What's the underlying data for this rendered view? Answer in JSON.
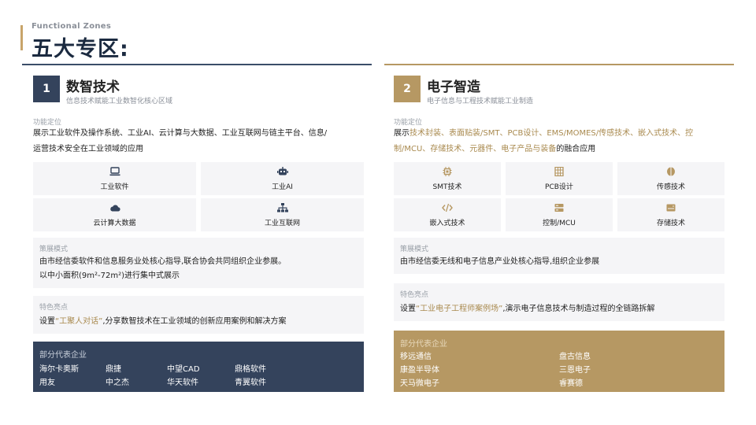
{
  "header": {
    "subtitle": "Functional Zones",
    "title": "五大专区:"
  },
  "zones": [
    {
      "number": "1",
      "title": "数智技术",
      "subtitle": "信息技术赋能工业数智化核心区域",
      "function_label": "功能定位",
      "function_text_1": "展示工业软件及操作系统、工业AI、云计算与大数据、工业互联网与链主平台、信息/",
      "function_text_2": "运营技术安全在工业领域的应用",
      "tiles": [
        {
          "label": "工业软件",
          "icon": "laptop-icon"
        },
        {
          "label": "工业AI",
          "icon": "robot-icon"
        },
        {
          "label": "云计算大数据",
          "icon": "cloud-icon"
        },
        {
          "label": "工业互联网",
          "icon": "network-icon"
        }
      ],
      "plan_label": "策展模式",
      "plan_text_1": "由市经信委软件和信息服务业处核心指导,联合协会共同组织企业参展。",
      "plan_text_2": "以中小面积(9m²-72m²)进行集中式展示",
      "feature_label": "特色亮点",
      "feature_prefix": "设置",
      "feature_highlight": "“工聚人对话”",
      "feature_suffix": ",分享数智技术在工业领域的创新应用案例和解决方案",
      "companies_label": "部分代表企业",
      "companies": [
        "海尔卡奥斯",
        "鼎捷",
        "中望CAD",
        "鼎格软件",
        "用友",
        "中之杰",
        "华天软件",
        "青翼软件"
      ]
    },
    {
      "number": "2",
      "title": "电子智造",
      "subtitle": "电子信息与工程技术赋能工业制造",
      "function_label": "功能定位",
      "function_prefix": "展示",
      "function_highlight_1": "技术封装、表面贴装/SMT、PCB设计、EMS/MOMES/传感技术、嵌入式技术、控",
      "function_highlight_2": "制/MCU、存储技术、元器件、电子产品与装备",
      "function_suffix": "的融合应用",
      "tiles": [
        {
          "label": "SMT技术",
          "icon": "chip-icon"
        },
        {
          "label": "PCB设计",
          "icon": "circuit-board-icon"
        },
        {
          "label": "传感技术",
          "icon": "sensor-icon"
        },
        {
          "label": "嵌入式技术",
          "icon": "code-icon"
        },
        {
          "label": "控制/MCU",
          "icon": "controller-icon"
        },
        {
          "label": "存储技术",
          "icon": "storage-icon"
        }
      ],
      "plan_label": "策展模式",
      "plan_text_1": "由市经信委无线和电子信息产业处核心指导,组织企业参展",
      "feature_label": "特色亮点",
      "feature_prefix": "设置",
      "feature_highlight": "“工业电子工程师案例场”",
      "feature_suffix": ",演示电子信息技术与制造过程的全链路拆解",
      "companies_label": "部分代表企业",
      "companies": [
        "移远通信",
        "盘古信息",
        "康盈半导体",
        "三恩电子",
        "天马微电子",
        "睿赛德"
      ]
    }
  ],
  "colors": {
    "navy": "#34435c",
    "gold": "#b69863",
    "tile_bg": "#f5f5f7"
  }
}
